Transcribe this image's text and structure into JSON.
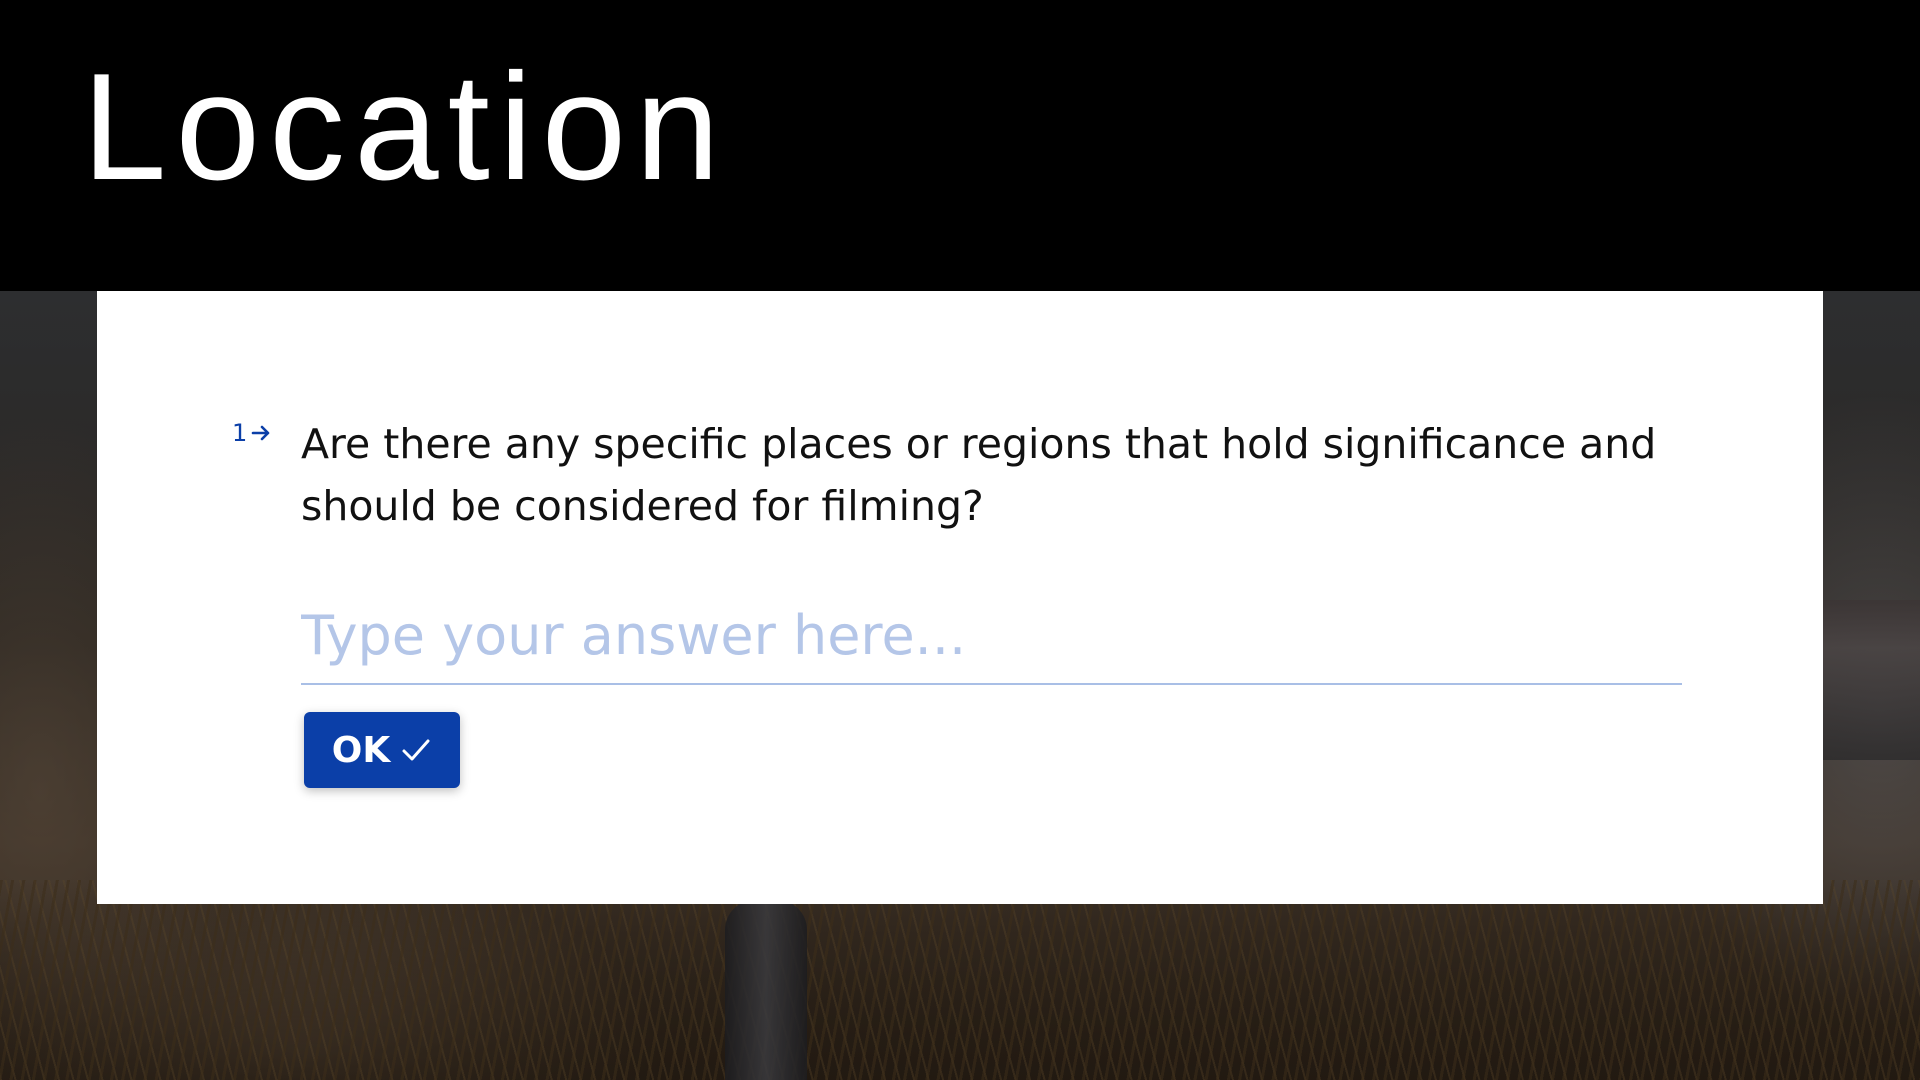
{
  "header": {
    "title": "Location"
  },
  "question": {
    "number": "1",
    "text": "Are there any specific places or regions that hold significance and should be considered for filming?"
  },
  "answer": {
    "value": "",
    "placeholder": "Type your answer here..."
  },
  "submit": {
    "label": "OK"
  },
  "colors": {
    "accent": "#0b3fa8",
    "placeholder": "#b4c6e8",
    "underline": "#a9bfe6",
    "title_bar": "#000000",
    "card": "#ffffff"
  },
  "icons": {
    "question_arrow": "arrow-right-icon",
    "ok_check": "check-icon"
  }
}
